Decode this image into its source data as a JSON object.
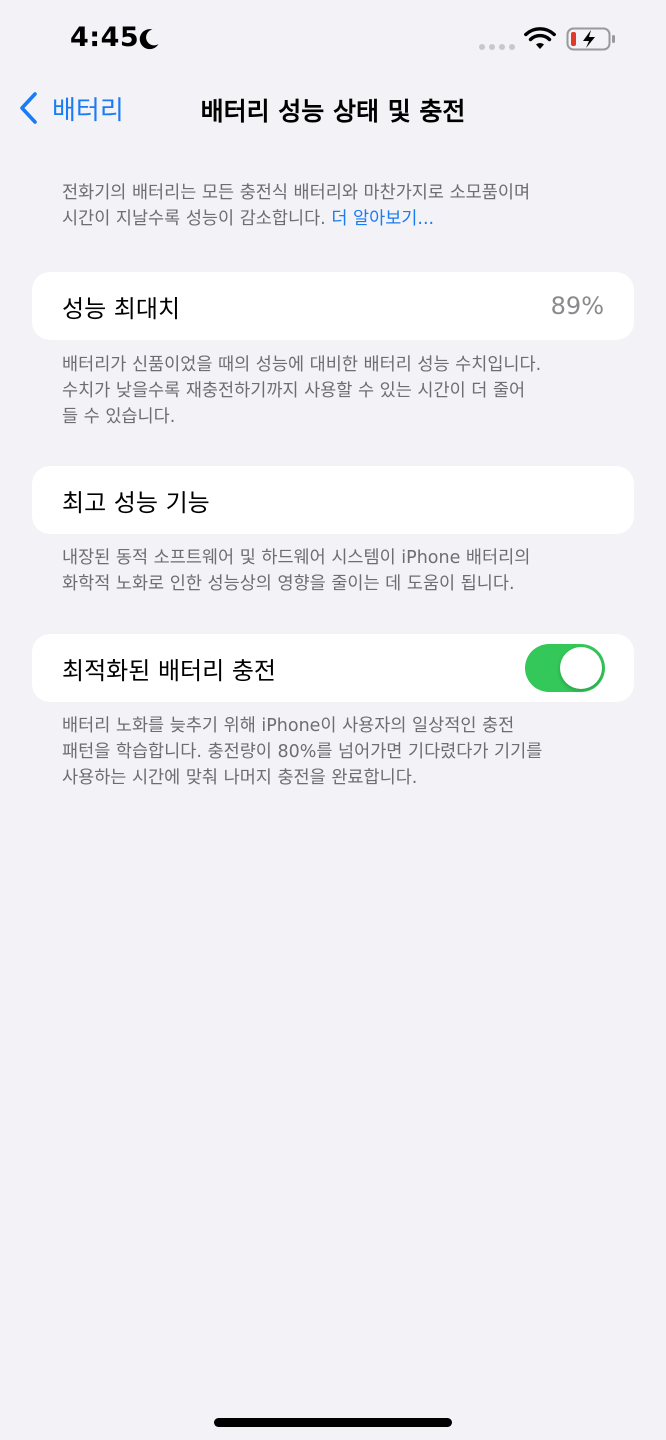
{
  "status_bar": {
    "time": "4:45",
    "icons": [
      "moon-icon",
      "signal-dots-icon",
      "wifi-icon",
      "battery-charging-icon"
    ],
    "battery_color": "#e0392b"
  },
  "nav": {
    "back_label": "배터리",
    "title": "배터리 성능 상태 및 충전"
  },
  "intro": {
    "line1": "전화기의 배터리는 모든 충전식 배터리와 마찬가지로 소모품이며",
    "line2": "시간이 지날수록 성능이 감소합니다.",
    "link": "더 알아보기..."
  },
  "max_capacity": {
    "label": "성능 최대치",
    "value": "89%",
    "footer": [
      "배터리가 신품이었을 때의 성능에 대비한 배터리 성능 수치입니다.",
      "수치가 낮을수록 재충전하기까지 사용할 수 있는 시간이 더 줄어",
      "들 수 있습니다."
    ]
  },
  "peak_performance": {
    "label": "최고 성능 기능",
    "footer": [
      "내장된 동적 소프트웨어 및 하드웨어 시스템이 iPhone 배터리의",
      "화학적 노화로 인한 성능상의 영향을 줄이는 데 도움이 됩니다."
    ]
  },
  "optimized_charging": {
    "label": "최적화된 배터리 충전",
    "enabled": true,
    "toggle_color": "#34c759",
    "footer": [
      "배터리 노화를 늦추기 위해 iPhone이 사용자의 일상적인 충전",
      "패턴을 학습합니다. 충전량이 80%를 넘어가면 기다렸다가 기기를",
      "사용하는 시간에 맞춰 나머지 충전을 완료합니다."
    ]
  },
  "colors": {
    "accent": "#1a7cf3",
    "background": "#f2f2f7",
    "secondary_text": "#6d6d72"
  }
}
